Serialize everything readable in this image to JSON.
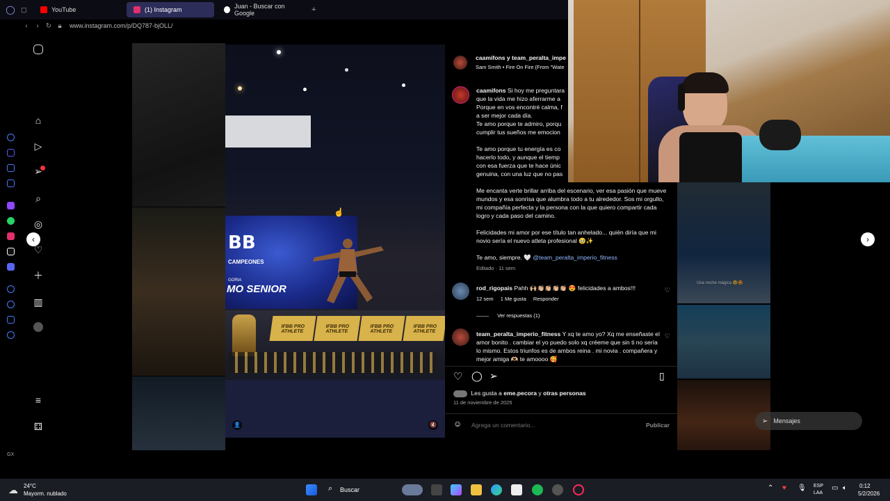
{
  "browser": {
    "tabs": [
      {
        "label": "YouTube",
        "color": "#ff0000"
      },
      {
        "label": "(1) Instagram",
        "color": "#e1306c"
      },
      {
        "label": "Juan - Buscar con Google",
        "color": "#4285f4"
      }
    ],
    "new_tab": "+",
    "url": "www.instagram.com/p/DQ787-bjOLL/"
  },
  "post": {
    "author_header": "caamifons y team_peralta_impe",
    "song": "Sam Smith • Fire On Fire (From \"Wate",
    "caption_author": "caamifons",
    "caption_lines_clipped": [
      "Si hoy me preguntara",
      "que la vida me hizo aferrarme a",
      "Porque en vos encontré calma, f",
      "a ser mejor cada día.",
      "Te amo porque te admiro, porqu",
      "cumplir tus sueños me emocion"
    ],
    "caption_para2_clipped": [
      "Te amo porque tu energía es co",
      "hacerlo todo, y aunque el tiemp",
      "con esa fuerza que te hace únic",
      "genuina, con una luz que no pas"
    ],
    "caption_para3": "Me encanta verte brillar arriba del escenario, ver esa pasión que mueve mundos y esa sonrisa que alumbra todo a tu alrededor. Sos mi orgullo, mi compañía perfecta y la persona con la que quiero compartir cada logro y cada paso del camino.",
    "caption_para4": "Felicidades mi amor por ese título tan anhelado... quién diría que mi novio sería el nuevo atleta profesional 🥹✨",
    "caption_para5": "Te amo, siempre. 🤍",
    "caption_mention": "@team_peralta_imperio_fitness",
    "caption_meta": "Editado · 11 sem",
    "comments": [
      {
        "user": "rod_rigopais",
        "text": "Pahh 🙌🏼👏🏼👏🏼👏🏼👏🏼 😍 felicidades a ambos!!!",
        "time": "12 sem",
        "likes": "1 Me gusta",
        "reply": "Responder",
        "view_replies": "Ver respuestas (1)"
      },
      {
        "user": "team_peralta_imperio_fitness",
        "text": "Y xq te amo yo? Xq me enseñaste el amor bonito . cambiar el yo puedo solo xq créeme que sin ti no sería lo mismo. Estos triunfos es de ambos reina . mi novia . compañera y mejor amiga 🫶🏼 te amoooo 🥰"
      }
    ],
    "likes_text": "Les gusta a",
    "likes_user": "eme.pecora",
    "likes_and": "y",
    "likes_others": "otras personas",
    "date": "11 de noviembre de 2025",
    "comment_placeholder": "Agrega un comentario...",
    "publish": "Publicar"
  },
  "media_overlay": {
    "banner_text": "BB",
    "banner_sub": "CAMPEONES",
    "banner_category": "MO SENIOR",
    "banner_cat_small": "GORIA",
    "table_cards": [
      "IFBB PRO ATHLETE",
      "IFBB PRO ATHLETE",
      "IFBB PRO ATHLETE",
      "IFBB PRO ATHLETE"
    ]
  },
  "bg_tiles_text": {
    "right_caption": "Una noche mágica 🥹🤩"
  },
  "messages_label": "Mensajes",
  "taskbar": {
    "weather_temp": "24°C",
    "weather_desc": "Mayorm. nublado",
    "search": "Buscar",
    "lang1": "ESP",
    "lang2": "LAA",
    "time": "0:12",
    "date": "5/2/2026"
  },
  "colors": {
    "accent_link": "#8fb8ff",
    "heart": "#ff3040",
    "taskbar_bg": "#1b1d24"
  }
}
